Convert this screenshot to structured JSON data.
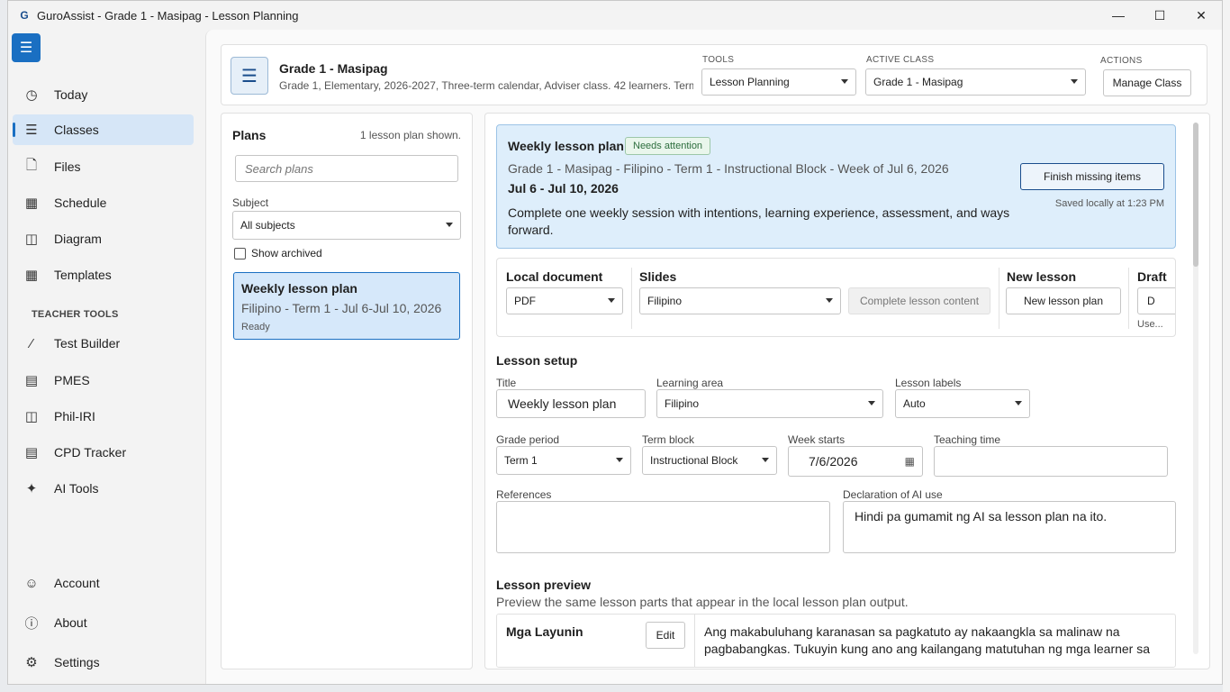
{
  "window": {
    "title": "GuroAssist - Grade 1 - Masipag - Lesson Planning",
    "app_icon": "G"
  },
  "sidebar": {
    "items": [
      {
        "label": "Today",
        "icon": "clock-icon"
      },
      {
        "label": "Classes",
        "icon": "list-icon"
      },
      {
        "label": "Files",
        "icon": "files-icon"
      },
      {
        "label": "Schedule",
        "icon": "calendar-icon"
      },
      {
        "label": "Diagram",
        "icon": "diagram-icon"
      },
      {
        "label": "Templates",
        "icon": "templates-icon"
      }
    ],
    "section_label": "TEACHER TOOLS",
    "tools": [
      {
        "label": "Test Builder",
        "icon": "test-builder-icon"
      },
      {
        "label": "PMES",
        "icon": "pmes-icon"
      },
      {
        "label": "Phil-IRI",
        "icon": "book-icon"
      },
      {
        "label": "CPD Tracker",
        "icon": "cpd-icon"
      },
      {
        "label": "AI Tools",
        "icon": "magic-wand-icon"
      }
    ],
    "bottom": [
      {
        "label": "Account",
        "icon": "account-icon"
      },
      {
        "label": "About",
        "icon": "info-icon"
      },
      {
        "label": "Settings",
        "icon": "gear-icon"
      }
    ]
  },
  "header": {
    "class_name": "Grade 1 - Masipag",
    "class_meta": "Grade 1, Elementary, 2026-2027, Three-term calendar, Adviser class. 42 learners. Term...",
    "tools_label": "TOOLS",
    "tools_value": "Lesson Planning",
    "active_class_label": "ACTIVE CLASS",
    "active_class_value": "Grade 1 - Masipag",
    "actions_label": "ACTIONS",
    "manage_class": "Manage Class"
  },
  "plans": {
    "title": "Plans",
    "count": "1 lesson plan shown.",
    "search_placeholder": "Search plans",
    "subject_label": "Subject",
    "subject_value": "All subjects",
    "show_archived": "Show archived",
    "items": [
      {
        "title": "Weekly lesson plan",
        "subtitle": "Filipino - Term 1 - Jul 6-Jul 10, 2026",
        "status": "Ready"
      }
    ]
  },
  "detail": {
    "title": "Weekly lesson plan",
    "badge": "Needs attention",
    "path": "Grade 1 - Masipag - Filipino - Term 1 - Instructional Block - Week of Jul 6, 2026",
    "dates": "Jul 6 - Jul 10, 2026",
    "description": "Complete one weekly session with intentions, learning experience, assessment, and ways forward.",
    "finish_button": "Finish missing items",
    "saved": "Saved locally at 1:23 PM",
    "local_document_label": "Local document",
    "local_document_value": "PDF",
    "slides_label": "Slides",
    "slides_value": "Filipino",
    "complete_content": "Complete lesson content",
    "new_lesson_label": "New lesson",
    "new_lesson_button": "New lesson plan",
    "draft_label": "Draft",
    "draft_button": "D",
    "draft_note": "Use..."
  },
  "setup": {
    "title": "Lesson setup",
    "title_label": "Title",
    "title_value": "Weekly lesson plan",
    "area_label": "Learning area",
    "area_value": "Filipino",
    "labels_label": "Lesson labels",
    "labels_value": "Auto",
    "period_label": "Grade period",
    "period_value": "Term 1",
    "block_label": "Term block",
    "block_value": "Instructional Block",
    "week_label": "Week starts",
    "week_value": "7/6/2026",
    "time_label": "Teaching time",
    "time_value": "",
    "refs_label": "References",
    "refs_value": "",
    "ai_label": "Declaration of AI use",
    "ai_value": "Hindi pa gumamit ng AI sa lesson plan na ito."
  },
  "preview": {
    "title": "Lesson preview",
    "subtitle": "Preview the same lesson parts that appear in the local lesson plan output.",
    "rows": [
      {
        "title": "Mga Layunin",
        "edit": "Edit",
        "text": "Ang makabuluhang karanasan sa pagkatuto ay nakaangkla sa malinaw na pagbabangkas. Tukuyin kung ano ang kailangang matutuhan ng mga learner sa"
      }
    ]
  },
  "colors": {
    "accent": "#1a6fc2",
    "selected_bg": "#d6e6f7",
    "status_bg": "#deeefb"
  }
}
